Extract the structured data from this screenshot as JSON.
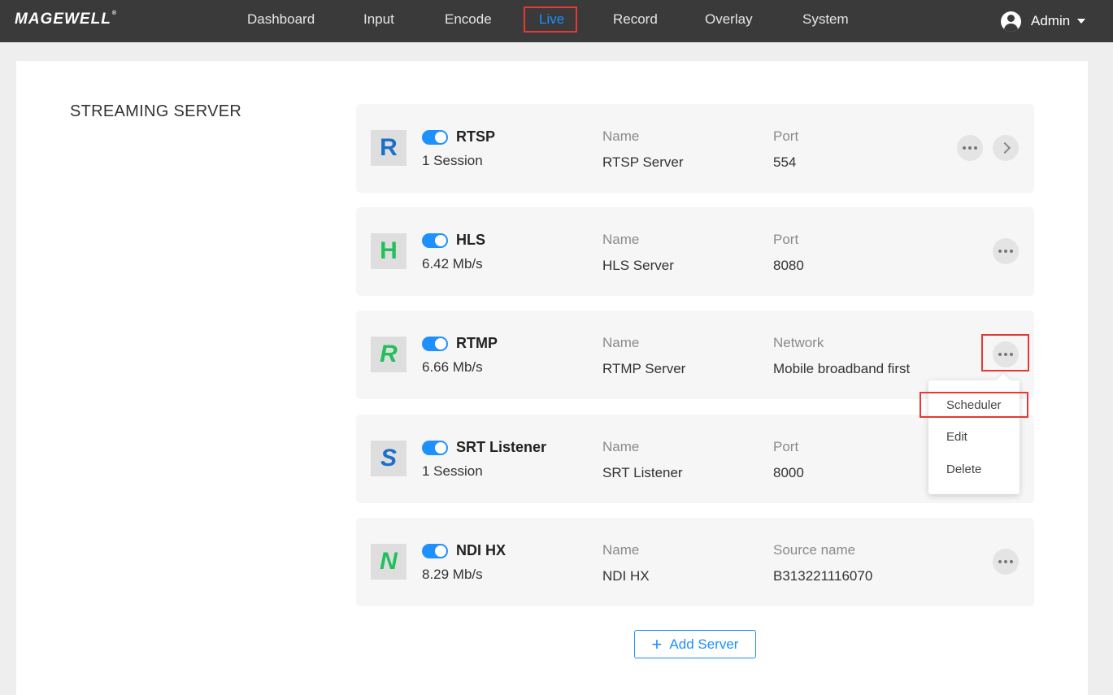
{
  "brand": {
    "logo_text": "MAGEWELL",
    "logo_mark": "®"
  },
  "nav": {
    "items": [
      "Dashboard",
      "Input",
      "Encode",
      "Live",
      "Record",
      "Overlay",
      "System"
    ],
    "active": "Live"
  },
  "user": {
    "name": "Admin"
  },
  "section": {
    "title": "STREAMING SERVER"
  },
  "servers": [
    {
      "letter": "R",
      "letter_color": "#1a6fc8",
      "protocol": "RTSP",
      "enabled": true,
      "stat": "1 Session",
      "field1_label": "Name",
      "field1_value": "RTSP Server",
      "field2_label": "Port",
      "field2_value": "554"
    },
    {
      "letter": "H",
      "letter_color": "#22c05a",
      "protocol": "HLS",
      "enabled": true,
      "stat": "6.42 Mb/s",
      "field1_label": "Name",
      "field1_value": "HLS Server",
      "field2_label": "Port",
      "field2_value": "8080"
    },
    {
      "letter": "R",
      "letter_color": "#22c05a",
      "protocol": "RTMP",
      "enabled": true,
      "stat": "6.66 Mb/s",
      "field1_label": "Name",
      "field1_value": "RTMP Server",
      "field2_label": "Network",
      "field2_value": "Mobile broadband first"
    },
    {
      "letter": "S",
      "letter_color": "#1a6fc8",
      "protocol": "SRT Listener",
      "enabled": true,
      "stat": "1 Session",
      "field1_label": "Name",
      "field1_value": "SRT Listener",
      "field2_label": "Port",
      "field2_value": "8000"
    },
    {
      "letter": "N",
      "letter_color": "#22c05a",
      "protocol": "NDI HX",
      "enabled": true,
      "stat": "8.29 Mb/s",
      "field1_label": "Name",
      "field1_value": "NDI HX",
      "field2_label": "Source name",
      "field2_value": "B313221116070"
    }
  ],
  "context_menu": {
    "items": [
      "Scheduler",
      "Edit",
      "Delete"
    ]
  },
  "add_server": {
    "plus": "+",
    "label": "Add Server"
  },
  "colors": {
    "accent": "#1e90ff",
    "highlight": "#e53935",
    "topbar": "#3a3a3a"
  }
}
